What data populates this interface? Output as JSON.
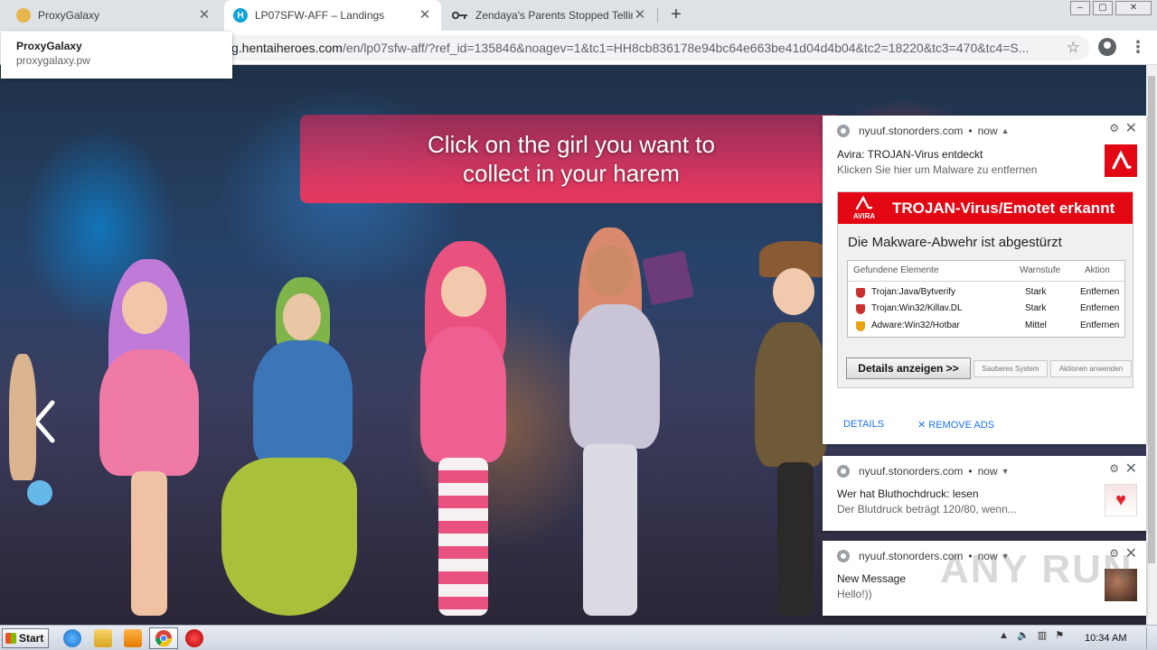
{
  "browser": {
    "tabs": [
      {
        "title": "ProxyGalaxy",
        "active": false
      },
      {
        "title": "LP07SFW-AFF – Landings",
        "active": true
      },
      {
        "title": "Zendaya's Parents Stopped Telling H",
        "active": false
      }
    ],
    "new_tab_label": "+",
    "window_controls": [
      "–",
      "▢",
      "✕"
    ],
    "url_host_visible": "g.hentaiheroes.com",
    "url_rest": "/en/lp07sfw-aff/?ref_id=135846&noagev=1&tc1=HH8cb836178e94bc64e663be41d04d4b04&tc2=18220&tc3=470&tc4=S..."
  },
  "hover_card": {
    "title": "ProxyGalaxy",
    "domain": "proxygalaxy.pw"
  },
  "page": {
    "banner_text": "Click on the girl you want to collect in your harem",
    "colors": {
      "banner": "#e93a5f",
      "arrow": "#ffffff"
    }
  },
  "notifications": [
    {
      "origin": "nyuuf.stonorders.com",
      "time": "now",
      "title": "Avira: TROJAN-Virus entdeckt",
      "body": "Klicken Sie hier um Malware zu entfernen",
      "icon": "avira-icon",
      "image": {
        "logo_text": "AVIRA",
        "headline": "TROJAN-Virus/Emotet erkannt",
        "subhead": "Die Makware-Abwehr ist abgestürzt",
        "columns": [
          "Gefundene Elemente",
          "Warnstufe",
          "Aktion"
        ],
        "rows": [
          {
            "name": "Trojan:Java/Bytverify",
            "level": "Stark",
            "action": "Entfernen"
          },
          {
            "name": "Trojan:Win32/Killav.DL",
            "level": "Stark",
            "action": "Entfernen"
          },
          {
            "name": "Adware:Win32/Hotbar",
            "level": "Mittel",
            "action": "Entfernen"
          }
        ],
        "button_main": "Details anzeigen >>",
        "button_2": "Sauberes System",
        "button_3": "Aktionen anwenden"
      },
      "actions": [
        "DETAILS",
        "✕ REMOVE ADS"
      ]
    },
    {
      "origin": "nyuuf.stonorders.com",
      "time": "now",
      "title": "Wer hat Bluthochdruck: lesen",
      "body": "Der Blutdruck beträgt 120/80, wenn...",
      "icon": "blood-pressure-icon"
    },
    {
      "origin": "nyuuf.stonorders.com",
      "time": "now",
      "title": "New Message",
      "body": "Hello!))",
      "icon": "photo-icon"
    }
  ],
  "watermark": "ANY RUN",
  "taskbar": {
    "start_label": "Start",
    "clock": "10:34 AM"
  }
}
